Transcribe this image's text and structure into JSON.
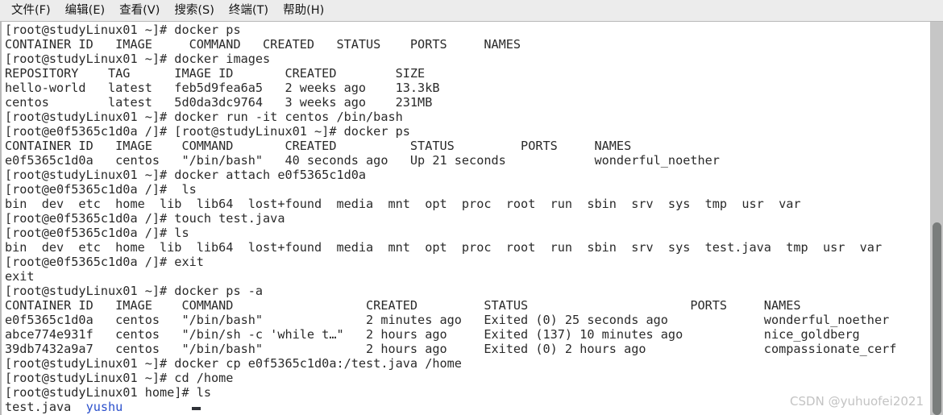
{
  "menubar": {
    "items": [
      {
        "label": "文件(F)",
        "name": "menu-file"
      },
      {
        "label": "编辑(E)",
        "name": "menu-edit"
      },
      {
        "label": "查看(V)",
        "name": "menu-view"
      },
      {
        "label": "搜索(S)",
        "name": "menu-search"
      },
      {
        "label": "终端(T)",
        "name": "menu-terminal"
      },
      {
        "label": "帮助(H)",
        "name": "menu-help"
      }
    ]
  },
  "terminal": {
    "host_prompt": "[root@studyLinux01 ~]# ",
    "container_prompt": "[root@e0f5365c1d0a /]# ",
    "lines": [
      {
        "text": "[root@studyLinux01 ~]# docker ps"
      },
      {
        "text": "CONTAINER ID   IMAGE     COMMAND   CREATED   STATUS    PORTS     NAMES"
      },
      {
        "text": "[root@studyLinux01 ~]# docker images"
      },
      {
        "text": "REPOSITORY    TAG      IMAGE ID       CREATED        SIZE"
      },
      {
        "text": "hello-world   latest   feb5d9fea6a5   2 weeks ago    13.3kB"
      },
      {
        "text": "centos        latest   5d0da3dc9764   3 weeks ago    231MB"
      },
      {
        "text": "[root@studyLinux01 ~]# docker run -it centos /bin/bash"
      },
      {
        "text": "[root@e0f5365c1d0a /]# [root@studyLinux01 ~]# docker ps"
      },
      {
        "text": "CONTAINER ID   IMAGE    COMMAND       CREATED          STATUS         PORTS     NAMES"
      },
      {
        "text": "e0f5365c1d0a   centos   \"/bin/bash\"   40 seconds ago   Up 21 seconds            wonderful_noether"
      },
      {
        "text": "[root@studyLinux01 ~]# docker attach e0f5365c1d0a"
      },
      {
        "text": "[root@e0f5365c1d0a /]#  ls"
      },
      {
        "text": "bin  dev  etc  home  lib  lib64  lost+found  media  mnt  opt  proc  root  run  sbin  srv  sys  tmp  usr  var"
      },
      {
        "text": "[root@e0f5365c1d0a /]# touch test.java"
      },
      {
        "text": "[root@e0f5365c1d0a /]# ls"
      },
      {
        "text": "bin  dev  etc  home  lib  lib64  lost+found  media  mnt  opt  proc  root  run  sbin  srv  sys  test.java  tmp  usr  var"
      },
      {
        "text": "[root@e0f5365c1d0a /]# exit"
      },
      {
        "text": "exit"
      },
      {
        "text": "[root@studyLinux01 ~]# docker ps -a"
      },
      {
        "text": "CONTAINER ID   IMAGE    COMMAND                  CREATED         STATUS                      PORTS     NAMES"
      },
      {
        "text": "e0f5365c1d0a   centos   \"/bin/bash\"              2 minutes ago   Exited (0) 25 seconds ago             wonderful_noether"
      },
      {
        "text": "abce774e931f   centos   \"/bin/sh -c 'while t…\"   2 hours ago     Exited (137) 10 minutes ago           nice_goldberg"
      },
      {
        "text": "39db7432a9a7   centos   \"/bin/bash\"              2 hours ago     Exited (0) 2 hours ago                compassionate_cerf"
      },
      {
        "text": "[root@studyLinux01 ~]# docker cp e0f5365c1d0a:/test.java /home"
      },
      {
        "text": "[root@studyLinux01 ~]# cd /home"
      },
      {
        "text": "[root@studyLinux01 home]# ls"
      },
      {
        "segments": [
          {
            "text": "test.java  ",
            "style": "plain"
          },
          {
            "text": "yushu",
            "style": "dir"
          }
        ]
      }
    ],
    "colors": {
      "foreground": "#2a2a2a",
      "background": "#ffffff",
      "directory": "#2b50cc"
    }
  },
  "docker_ps_table": {
    "headers": [
      "CONTAINER ID",
      "IMAGE",
      "COMMAND",
      "CREATED",
      "STATUS",
      "PORTS",
      "NAMES"
    ],
    "running_rows": [
      [
        "e0f5365c1d0a",
        "centos",
        "\"/bin/bash\"",
        "40 seconds ago",
        "Up 21 seconds",
        "",
        "wonderful_noether"
      ]
    ],
    "all_rows": [
      [
        "e0f5365c1d0a",
        "centos",
        "\"/bin/bash\"",
        "2 minutes ago",
        "Exited (0) 25 seconds ago",
        "",
        "wonderful_noether"
      ],
      [
        "abce774e931f",
        "centos",
        "\"/bin/sh -c 'while t…\"",
        "2 hours ago",
        "Exited (137) 10 minutes ago",
        "",
        "nice_goldberg"
      ],
      [
        "39db7432a9a7",
        "centos",
        "\"/bin/bash\"",
        "2 hours ago",
        "Exited (0) 2 hours ago",
        "",
        "compassionate_cerf"
      ]
    ]
  },
  "docker_images_table": {
    "headers": [
      "REPOSITORY",
      "TAG",
      "IMAGE ID",
      "CREATED",
      "SIZE"
    ],
    "rows": [
      [
        "hello-world",
        "latest",
        "feb5d9fea6a5",
        "2 weeks ago",
        "13.3kB"
      ],
      [
        "centos",
        "latest",
        "5d0da3dc9764",
        "3 weeks ago",
        "231MB"
      ]
    ]
  },
  "scrollbar": {
    "thumb_top_pct": 51,
    "thumb_height_pct": 49
  },
  "watermark": {
    "text": "CSDN @yuhuofei2021"
  }
}
